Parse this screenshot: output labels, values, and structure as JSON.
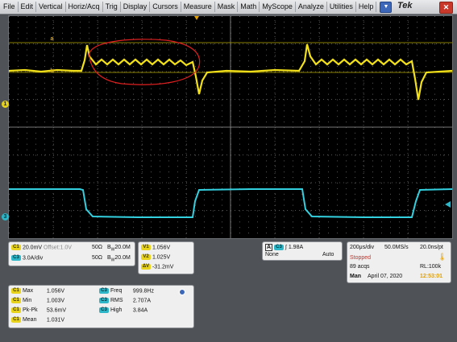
{
  "menu": [
    "File",
    "Edit",
    "Vertical",
    "Horiz/Acq",
    "Trig",
    "Display",
    "Cursors",
    "Measure",
    "Mask",
    "Math",
    "MyScope",
    "Analyze",
    "Utilities",
    "Help"
  ],
  "brand": "Tek",
  "close_label": "✕",
  "dropdown_label": "▼",
  "markers": {
    "ch1": "1",
    "ch3": "3",
    "cursor_a": "a",
    "cursor_b": "b"
  },
  "channels": {
    "ch1": {
      "chip": "C1",
      "scale": "20.0mV",
      "offset": "Offset:1.0V",
      "impedance": "50Ω",
      "bw": "20.0M",
      "color": "#e7d21c"
    },
    "ch3": {
      "chip": "C3",
      "scale": "3.0A/div",
      "impedance": "50Ω",
      "bw": "20.0M",
      "color": "#2db6c7"
    },
    "bw_label": "W"
  },
  "cursor_readout": {
    "v1_label": "V1",
    "v1": "1.056V",
    "v2_label": "V2",
    "v2": "1.025V",
    "dv_label": "ΔV",
    "dv": "-31.2mV"
  },
  "trigger": {
    "a_label": "A",
    "chip": "C3",
    "slope": "∫",
    "level": "1.98A",
    "source": "None",
    "mode": "Auto"
  },
  "acquisition": {
    "timebase": "200μs/div",
    "samplerate": "50.0MS/s",
    "resolution": "20.0ns/pt",
    "state": "Stopped",
    "acqs": "89 acqs",
    "record": "RL:100k",
    "mode": "Man",
    "date": "April 07, 2020",
    "time": "12:53:01"
  },
  "measurements": [
    {
      "chip": "C1",
      "label": "Max",
      "value": "1.056V"
    },
    {
      "chip": "C1",
      "label": "Min",
      "value": "1.003V"
    },
    {
      "chip": "C1",
      "label": "Pk-Pk",
      "value": "53.6mV"
    },
    {
      "chip": "C1",
      "label": "Mean",
      "value": "1.031V"
    }
  ],
  "measurements_right": [
    {
      "chip": "C3",
      "label": "Freq",
      "value": "999.8Hz"
    },
    {
      "chip": "C3",
      "label": "RMS",
      "value": "2.707A"
    },
    {
      "chip": "C3",
      "label": "High",
      "value": "3.84A"
    }
  ],
  "colors": {
    "ch1": "#f2e01a",
    "ch3": "#33d0e0",
    "annotation": "#e02020",
    "stopped": "#d62b1e",
    "time": "#e3a000"
  }
}
